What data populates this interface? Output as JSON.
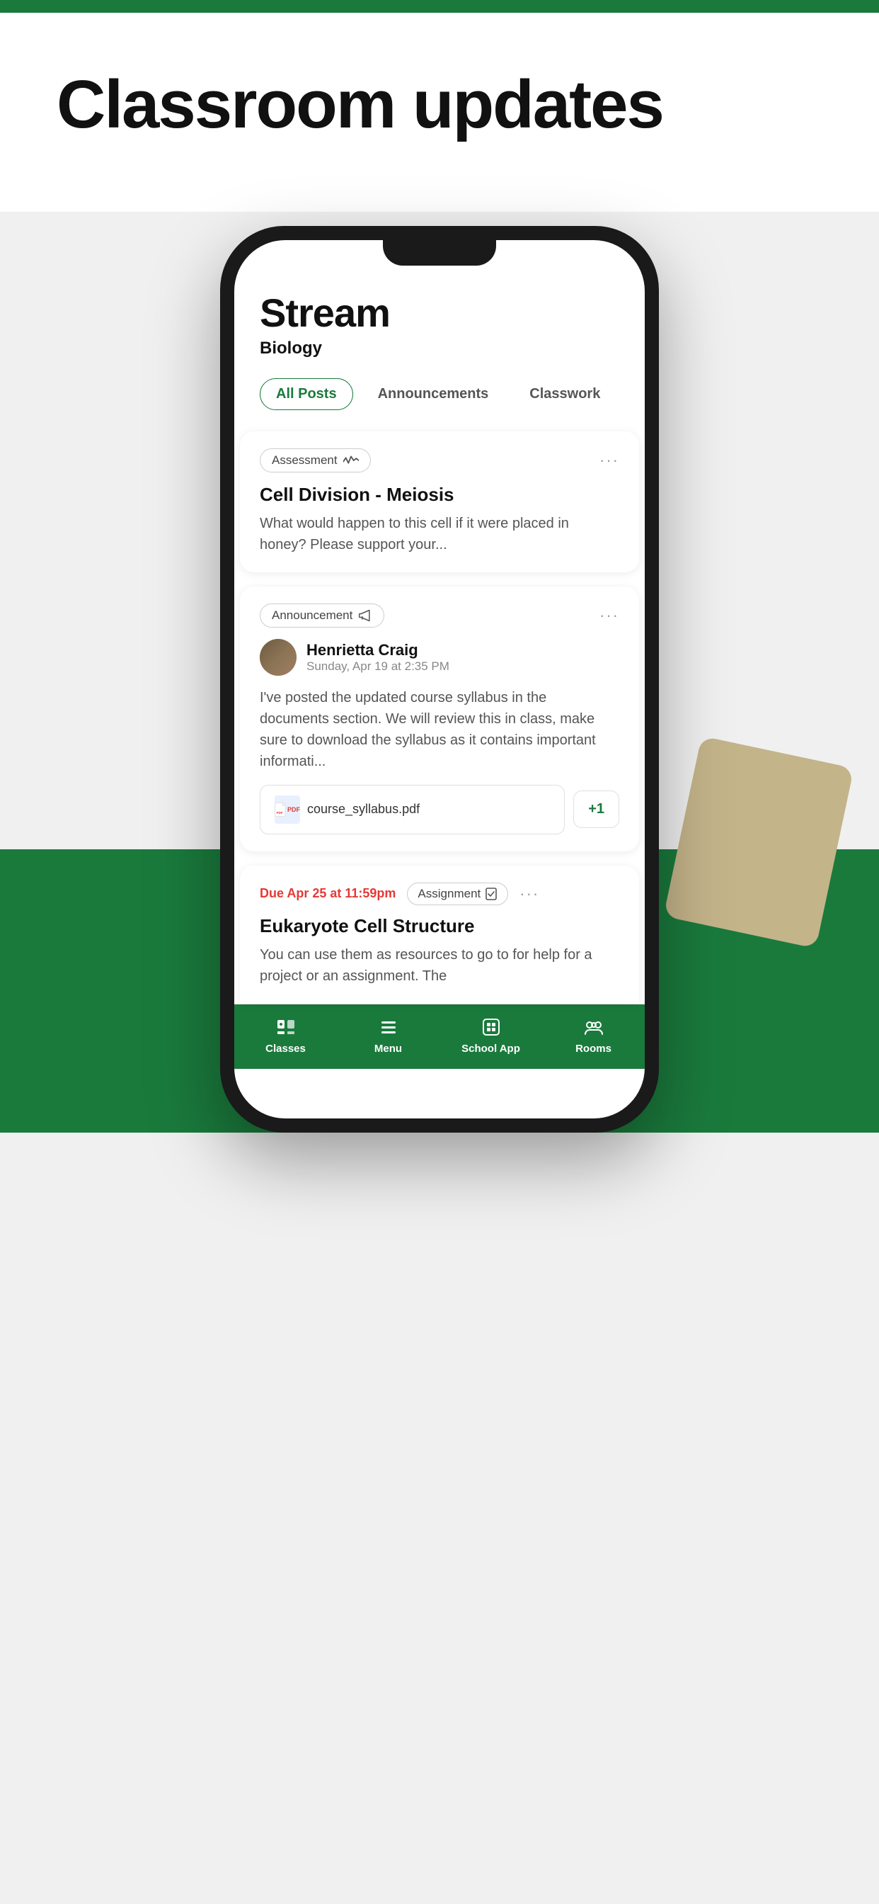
{
  "page": {
    "top_bar_color": "#1a7a3c",
    "title": "Classroom updates"
  },
  "stream": {
    "title": "Stream",
    "subtitle": "Biology"
  },
  "tabs": [
    {
      "label": "All Posts",
      "active": true
    },
    {
      "label": "Announcements",
      "active": false
    },
    {
      "label": "Classwork",
      "active": false
    }
  ],
  "cards": [
    {
      "tag": "Assessment",
      "title": "Cell Division - Meiosis",
      "body": "What would happen to this cell if it were placed in honey? Please support your..."
    },
    {
      "tag": "Announcement",
      "user_name": "Henrietta Craig",
      "user_date": "Sunday, Apr 19 at 2:35 PM",
      "body": "I've posted the updated course syllabus in the documents section. We will review this in class, make sure to download the syllabus as it contains important informati...",
      "attachment": "course_syllabus.pdf",
      "extra_count": "+1"
    },
    {
      "due": "Due Apr 25 at 11:59pm",
      "tag": "Assignment",
      "title": "Eukaryote Cell Structure",
      "body": "You can use them as resources to go to for help for a project or an assignment. The"
    }
  ],
  "bottom_nav": [
    {
      "label": "Classes",
      "active": false,
      "icon": "classes"
    },
    {
      "label": "Menu",
      "active": false,
      "icon": "menu"
    },
    {
      "label": "School App",
      "active": true,
      "icon": "school-app"
    },
    {
      "label": "Rooms",
      "active": true,
      "icon": "rooms"
    }
  ]
}
